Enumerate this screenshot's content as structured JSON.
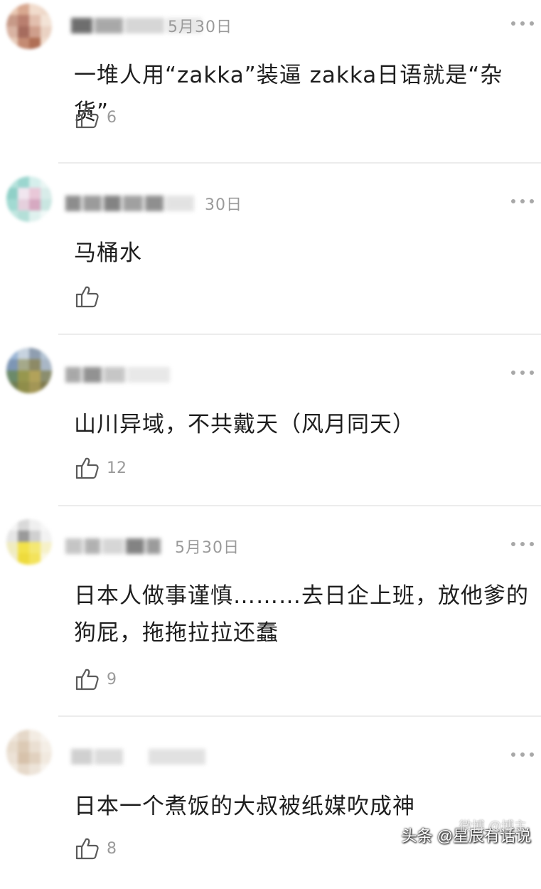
{
  "comments": [
    {
      "date": "5月30日",
      "text": "一堆人用“zakka”装逼 zakka日语就是“杂货”",
      "likes": "6"
    },
    {
      "date": "30日",
      "text": "马桶水",
      "likes": ""
    },
    {
      "date": "",
      "text": "山川异域，不共戴天（风月同天）",
      "likes": "12"
    },
    {
      "date": "5月30日",
      "text": "日本人做事谨慎………去日企上班，放他爹的狗屁，拖拖拉拉还蠢",
      "likes": "9"
    },
    {
      "date": "",
      "text": "日本一个煮饭的大叔被纸媒吹成神",
      "likes": "8"
    }
  ],
  "icons": {
    "like": "thumbs-up-icon",
    "more": "more-dots-icon"
  },
  "watermark": {
    "text": "头条 @星辰有话说",
    "ghost": "微博 @博主"
  },
  "colors": {
    "text": "#1e1e1e",
    "meta": "#9a9a9a",
    "divider": "#ececec",
    "icon": "#a8a8a8"
  }
}
